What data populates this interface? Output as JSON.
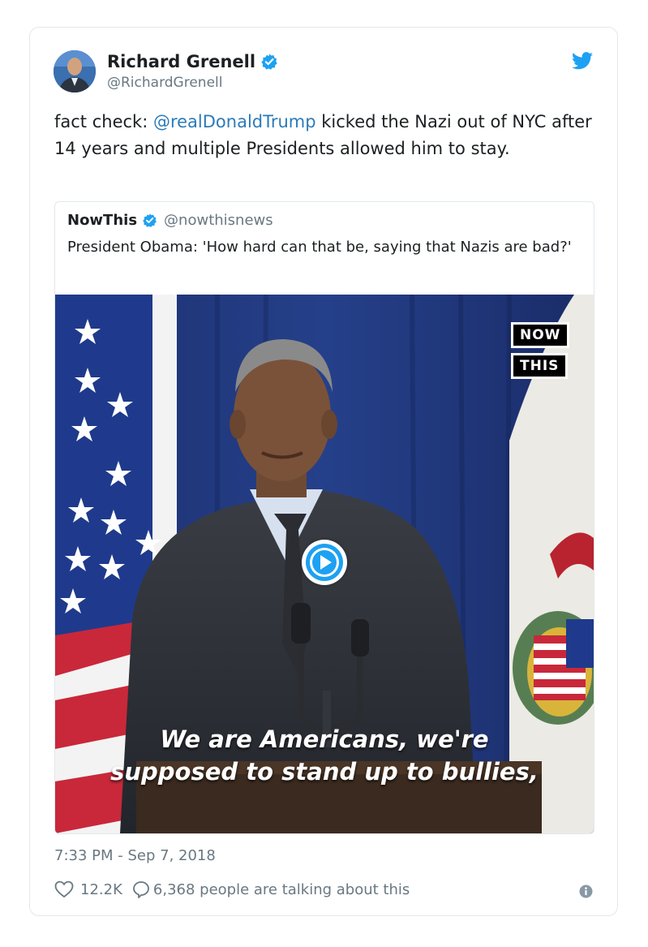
{
  "author": {
    "name": "Richard Grenell",
    "handle": "@RichardGrenell"
  },
  "tweet": {
    "text_before": "fact check: ",
    "mention": "@realDonaldTrump",
    "text_after": " kicked the Nazi out of NYC after 14 years and multiple Presidents allowed him to stay."
  },
  "quoted": {
    "name": "NowThis",
    "handle": "@nowthisnews",
    "text": "President Obama: 'How hard can that be, saying that Nazis are bad?'",
    "logo_line1": "NOW",
    "logo_line2": "THIS",
    "caption_line1": "We are Americans, we're",
    "caption_line2": "supposed to stand up to bullies,"
  },
  "timestamp": "7:33 PM - Sep 7, 2018",
  "actions": {
    "likes": "12.2K",
    "talking": "6,368 people are talking about this"
  },
  "colors": {
    "link": "#2b7bb9",
    "verified": "#1da1f2",
    "muted": "#697882"
  },
  "icons": [
    "verified-badge-icon",
    "twitter-bird-icon",
    "play-icon",
    "heart-icon",
    "comment-bubble-icon",
    "info-icon"
  ]
}
